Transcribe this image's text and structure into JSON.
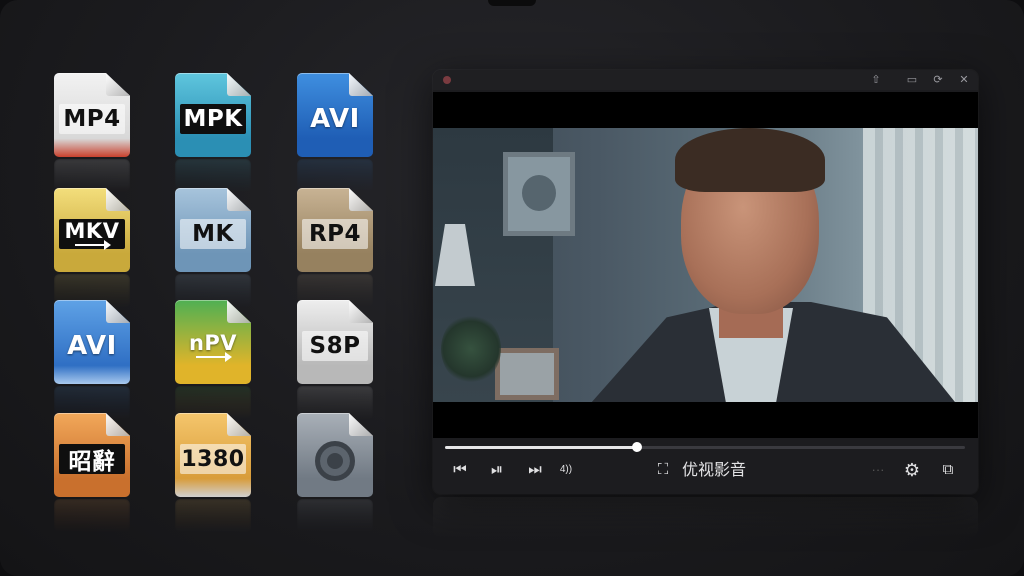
{
  "file_icons": [
    {
      "label": "MP4",
      "icon": "mp4-file-icon",
      "body": [
        "#f2f2f2",
        "#d8d8d8"
      ],
      "bottom": "#c9412d",
      "band": "light"
    },
    {
      "label": "MPK",
      "icon": "mpk-file-icon",
      "body": [
        "#5fc6de",
        "#2b8fb4"
      ],
      "bottom": "#2b8fb4",
      "band": "dark"
    },
    {
      "label": "AVI",
      "icon": "avi-file-icon",
      "body": [
        "#3f8fe0",
        "#1f5eb5"
      ],
      "bottom": "#1f5eb5",
      "band": "none"
    },
    {
      "label": "MKV",
      "icon": "mkv-file-icon",
      "body": [
        "#f3de7c",
        "#c9a93b"
      ],
      "bottom": "#c9a93b",
      "band": "dark",
      "arrow": true
    },
    {
      "label": "MK",
      "icon": "mk-file-icon",
      "body": [
        "#a7c4dc",
        "#6e95b7"
      ],
      "bottom": "#6e95b7",
      "band": "light"
    },
    {
      "label": "RP4",
      "icon": "rp4-file-icon",
      "body": [
        "#c8b394",
        "#96815f"
      ],
      "bottom": "#96815f",
      "band": "light"
    },
    {
      "label": "AVI",
      "icon": "avi-file-icon",
      "body": [
        "#5fa2e6",
        "#2f6fc4"
      ],
      "bottom": "#a9c9ee",
      "band": "none"
    },
    {
      "label": "nPV",
      "icon": "npv-file-icon",
      "body": [
        "#4fb053",
        "#e0b42a"
      ],
      "bottom": "#e0b42a",
      "band": "none",
      "arrow": true
    },
    {
      "label": "S8P",
      "icon": "s8p-file-icon",
      "body": [
        "#eeeeee",
        "#b8b8b8"
      ],
      "bottom": "#b8b8b8",
      "band": "light"
    },
    {
      "label": "昭辭",
      "icon": "orange-file-icon",
      "body": [
        "#f2a85a",
        "#c9702d"
      ],
      "bottom": "#c9702d",
      "band": "dark"
    },
    {
      "label": "1380",
      "icon": "1380-file-icon",
      "body": [
        "#f5c66c",
        "#d89c3a"
      ],
      "bottom": "#d0d0d0",
      "band": "light"
    },
    {
      "label": "",
      "icon": "settings-file-icon",
      "body": [
        "#a9b0b8",
        "#717a84"
      ],
      "bottom": "#717a84",
      "band": "none",
      "symbol": true
    }
  ],
  "player": {
    "title": "优视影音",
    "progress": 0.37,
    "icons": {
      "titlebar": [
        "pin-icon",
        "minimize-icon",
        "fullscreen-icon",
        "close-icon"
      ],
      "controls": [
        "previous-icon",
        "play-pause-icon",
        "next-icon",
        "volume-icon",
        "expand-icon",
        "more-icon",
        "settings-icon",
        "pip-icon"
      ]
    },
    "glyphs": {
      "pin": "⇧",
      "minimize": "▭",
      "fullscreen": "⟳",
      "close": "✕",
      "previous": "⏮",
      "play_pause": "⏯",
      "next": "⏭",
      "volume": "4))",
      "expand": "⛶",
      "more": "···",
      "settings": "⚙",
      "pip": "⧉"
    }
  }
}
